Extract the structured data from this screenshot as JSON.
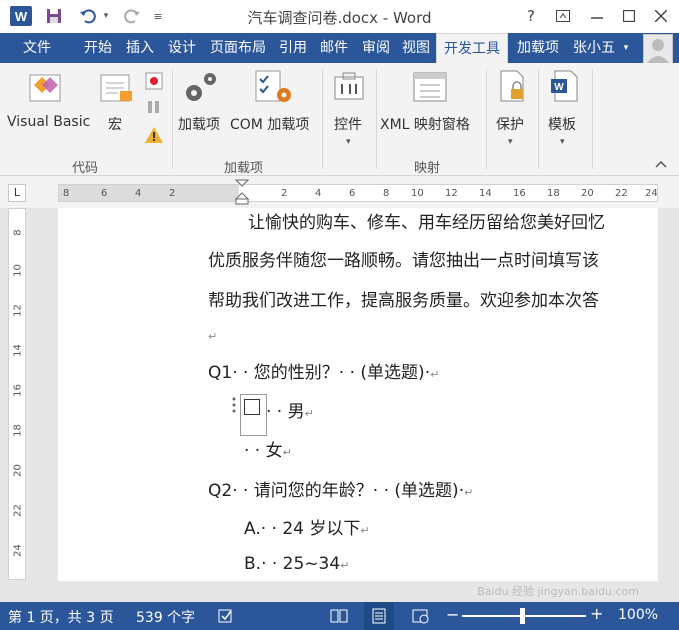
{
  "titlebar": {
    "logo": "W",
    "title": "汽车调查问卷.docx - Word",
    "help": "?"
  },
  "tabs": [
    "文件",
    "开始",
    "插入",
    "设计",
    "页面布局",
    "引用",
    "邮件",
    "审阅",
    "视图",
    "开发工具",
    "加载项",
    "张小五"
  ],
  "ribbon": {
    "vb_label": "Visual Basic",
    "macro_label": "宏",
    "addins_label": "加载项",
    "com_addins_label": "COM 加载项",
    "controls_label": "控件",
    "xml_label": "XML 映射窗格",
    "protect_label": "保护",
    "template_label": "模板",
    "group_code": "代码",
    "group_addins": "加载项",
    "group_mapping": "映射"
  },
  "ruler": {
    "corner": "L",
    "h_ticks": [
      "8",
      "6",
      "4",
      "2",
      "2",
      "4",
      "6",
      "8",
      "10",
      "12",
      "14",
      "16",
      "18",
      "20",
      "22",
      "24"
    ],
    "v_ticks": [
      "8",
      "10",
      "12",
      "14",
      "16",
      "18",
      "20",
      "22",
      "24"
    ]
  },
  "document": {
    "para1": "让愉快的购车、修车、用车经历留给您美好回忆",
    "para2": "优质服务伴随您一路顺畅。请您抽出一点时间填写该",
    "para3": "帮助我们改进工作，提高服务质量。欢迎参加本次答",
    "q1": "Q1· · 您的性别？· · (单选题)·",
    "q1_opt1": "· · 男",
    "q1_opt2": "· · 女",
    "q2": "Q2· · 请问您的年龄？· · (单选题)·",
    "q2_opt1": "A.· · 24 岁以下",
    "q2_opt2": "B.· · 25~34",
    "para_mark": "↵"
  },
  "statusbar": {
    "page": "第 1 页，共 3 页",
    "words": "539 个字",
    "zoom": "100%"
  },
  "watermark": "Baidu 经验 jingyan.baidu.com",
  "colors": {
    "accent": "#2b579a",
    "ribbon_bg": "#f3f3f3"
  }
}
